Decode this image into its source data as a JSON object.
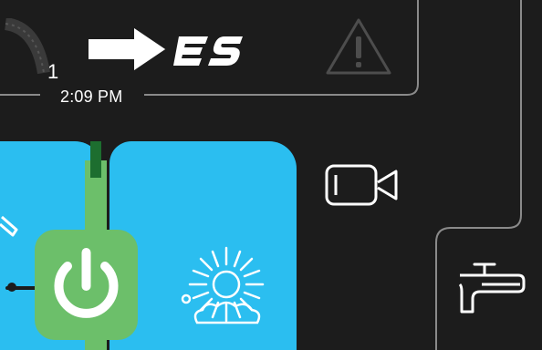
{
  "header": {
    "count": "1",
    "time": "2:09 PM",
    "logo_text": "ES"
  },
  "icons": {
    "arrow": "right-arrow-icon",
    "warning": "warning-triangle-icon",
    "camera": "video-camera-icon",
    "faucet": "faucet-icon",
    "power": "power-icon",
    "sun_wash": "sun-wash-icon",
    "gauge": "gauge-icon",
    "edit": "pencil-icon"
  },
  "colors": {
    "background": "#1c1c1c",
    "panel_blue": "#2bbef0",
    "power_green": "#6cbf6a",
    "track_dark_green": "#1d6e2f",
    "outline_grey": "#8a8a8a"
  }
}
